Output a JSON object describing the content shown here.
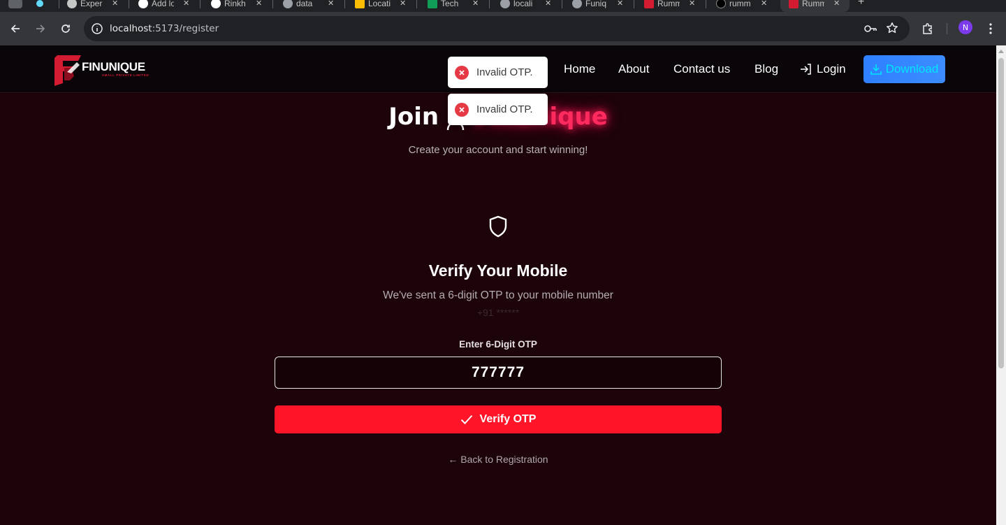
{
  "browser": {
    "tabs": [
      {
        "label": ""
      },
      {
        "label": "Experi"
      },
      {
        "label": "Add lo"
      },
      {
        "label": "Rinkh"
      },
      {
        "label": "data"
      },
      {
        "label": "Locati"
      },
      {
        "label": "Tech"
      },
      {
        "label": "locali"
      },
      {
        "label": "Funiq"
      },
      {
        "label": "Rumm"
      },
      {
        "label": "rumm"
      },
      {
        "label": "Rumm"
      }
    ],
    "url_host": "localhost",
    "url_path": ":5173/register",
    "profile_initial": "N"
  },
  "navbar": {
    "logo_name": "FINUNIQUE",
    "logo_sub": "SMALL PRIVATE LIMITED",
    "links": {
      "home": "Home",
      "about": "About",
      "contact": "Contact us",
      "blog": "Blog",
      "login": "Login"
    },
    "download_label": "Download"
  },
  "hero": {
    "join": "Join",
    "brand": "Finunique",
    "subtitle": "Create your account and start winning!"
  },
  "verify": {
    "title": "Verify Your Mobile",
    "subtitle": "We've sent a 6-digit OTP to your mobile number",
    "phone": "+91 ******",
    "otp_label": "Enter 6-Digit OTP",
    "otp_value": "777777",
    "button_label": "Verify OTP",
    "back_label": "← Back to Registration"
  },
  "toasts": [
    {
      "message": "Invalid OTP."
    },
    {
      "message": "Invalid OTP."
    }
  ],
  "colors": {
    "accent_red": "#ff1428",
    "brand_pink": "#ff2a5e",
    "download_blue": "#3b82f6",
    "download_text": "#00e5ff",
    "page_bg": "#1d030a"
  }
}
